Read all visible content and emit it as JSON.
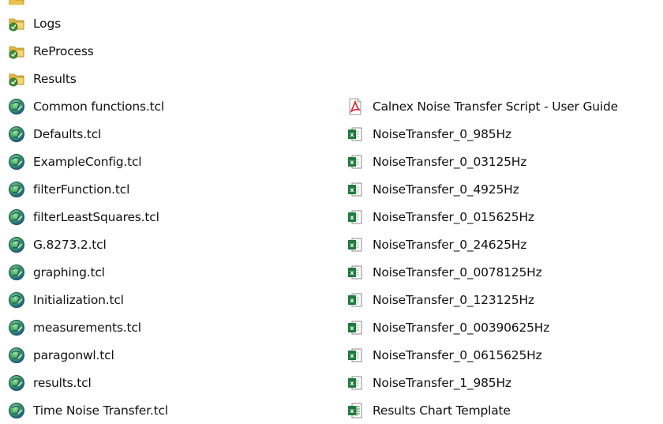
{
  "left_items": [
    {
      "label": "Logs",
      "icon": "folder-icon"
    },
    {
      "label": "ReProcess",
      "icon": "folder-icon"
    },
    {
      "label": "Results",
      "icon": "folder-icon"
    },
    {
      "label": "Common functions.tcl",
      "icon": "tcl-script-icon"
    },
    {
      "label": "Defaults.tcl",
      "icon": "tcl-script-icon"
    },
    {
      "label": "ExampleConfig.tcl",
      "icon": "tcl-script-icon"
    },
    {
      "label": "filterFunction.tcl",
      "icon": "tcl-script-icon"
    },
    {
      "label": "filterLeastSquares.tcl",
      "icon": "tcl-script-icon"
    },
    {
      "label": "G.8273.2.tcl",
      "icon": "tcl-script-icon"
    },
    {
      "label": "graphing.tcl",
      "icon": "tcl-script-icon"
    },
    {
      "label": "Initialization.tcl",
      "icon": "tcl-script-icon"
    },
    {
      "label": "measurements.tcl",
      "icon": "tcl-script-icon"
    },
    {
      "label": "paragonwl.tcl",
      "icon": "tcl-script-icon"
    },
    {
      "label": "results.tcl",
      "icon": "tcl-script-icon"
    },
    {
      "label": "Time Noise Transfer.tcl",
      "icon": "tcl-script-icon"
    }
  ],
  "right_items": [
    {
      "label": "Calnex Noise Transfer Script - User Guide",
      "icon": "pdf-icon"
    },
    {
      "label": "NoiseTransfer_0_985Hz",
      "icon": "excel-csv-icon"
    },
    {
      "label": "NoiseTransfer_0_03125Hz",
      "icon": "excel-csv-icon"
    },
    {
      "label": "NoiseTransfer_0_4925Hz",
      "icon": "excel-csv-icon"
    },
    {
      "label": "NoiseTransfer_0_015625Hz",
      "icon": "excel-csv-icon"
    },
    {
      "label": "NoiseTransfer_0_24625Hz",
      "icon": "excel-csv-icon"
    },
    {
      "label": "NoiseTransfer_0_0078125Hz",
      "icon": "excel-csv-icon"
    },
    {
      "label": "NoiseTransfer_0_123125Hz",
      "icon": "excel-csv-icon"
    },
    {
      "label": "NoiseTransfer_0_00390625Hz",
      "icon": "excel-csv-icon"
    },
    {
      "label": "NoiseTransfer_0_0615625Hz",
      "icon": "excel-csv-icon"
    },
    {
      "label": "NoiseTransfer_1_985Hz",
      "icon": "excel-csv-icon"
    },
    {
      "label": "Results Chart Template",
      "icon": "excel-template-icon"
    }
  ]
}
